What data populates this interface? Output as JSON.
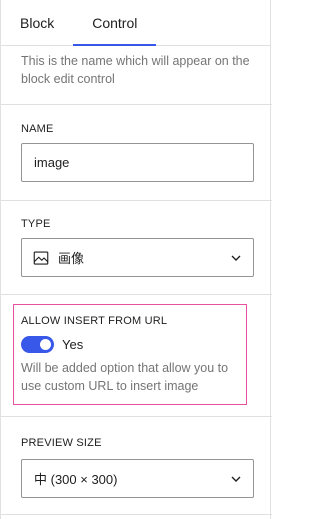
{
  "tabs": [
    {
      "label": "Block"
    },
    {
      "label": "Control"
    }
  ],
  "intro_help": "This is the name which will appear on the block edit control",
  "name_field": {
    "label": "NAME",
    "value": "image"
  },
  "type_field": {
    "label": "TYPE",
    "value": "画像",
    "icon": "image-icon"
  },
  "allow_url": {
    "label": "ALLOW INSERT FROM URL",
    "toggle_label": "Yes",
    "enabled": true,
    "help": "Will be added option that allow you to use custom URL to insert image"
  },
  "preview_size": {
    "label": "PREVIEW SIZE",
    "value": "中 (300 × 300)"
  },
  "colors": {
    "accent": "#3858e9",
    "highlight_border": "#e8519f"
  }
}
